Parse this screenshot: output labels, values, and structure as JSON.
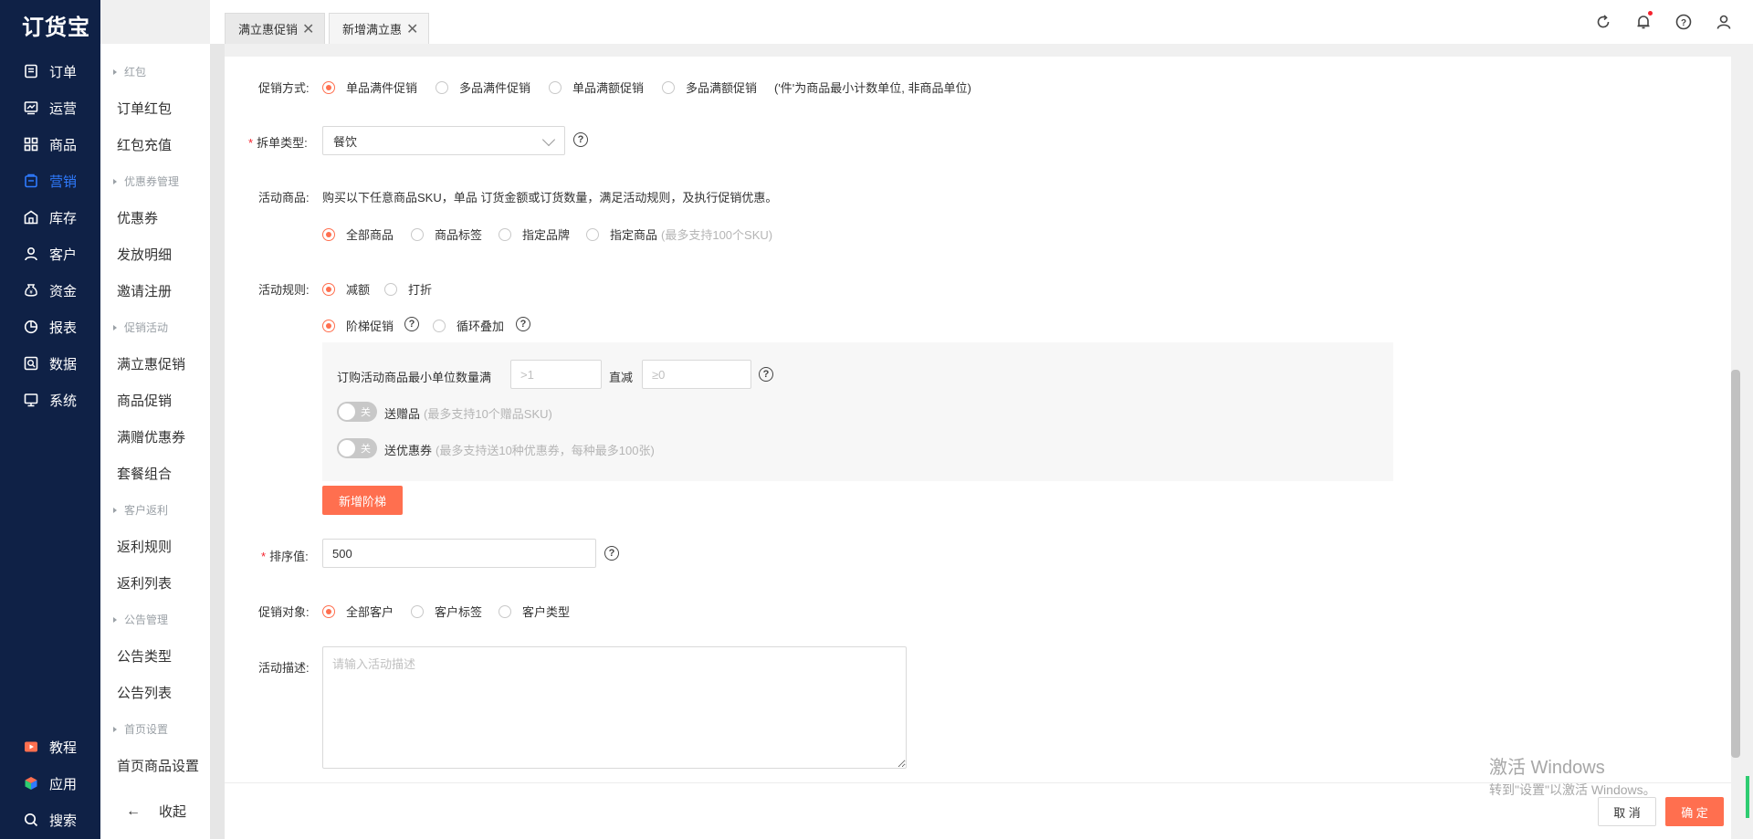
{
  "app": {
    "logo": "订货宝"
  },
  "sidebar": {
    "items": [
      {
        "label": "订单",
        "icon": "order-icon"
      },
      {
        "label": "运营",
        "icon": "operation-icon"
      },
      {
        "label": "商品",
        "icon": "product-icon"
      },
      {
        "label": "营销",
        "icon": "marketing-icon",
        "active": true
      },
      {
        "label": "库存",
        "icon": "warehouse-icon"
      },
      {
        "label": "客户",
        "icon": "customer-icon"
      },
      {
        "label": "资金",
        "icon": "funds-icon"
      },
      {
        "label": "报表",
        "icon": "report-icon"
      },
      {
        "label": "数据",
        "icon": "data-icon"
      },
      {
        "label": "系统",
        "icon": "system-icon"
      }
    ],
    "bottom": [
      {
        "label": "教程",
        "icon": "tutorial-icon"
      },
      {
        "label": "应用",
        "icon": "apps-icon"
      },
      {
        "label": "搜索",
        "icon": "search-icon"
      }
    ]
  },
  "submenu": {
    "groups": [
      {
        "title": "红包",
        "items": [
          "订单红包",
          "红包充值"
        ]
      },
      {
        "title": "优惠券管理",
        "items": [
          "优惠券",
          "发放明细",
          "邀请注册"
        ]
      },
      {
        "title": "促销活动",
        "items": [
          "满立惠促销",
          "商品促销",
          "满赠优惠券",
          "套餐组合"
        ]
      },
      {
        "title": "客户返利",
        "items": [
          "返利规则",
          "返利列表"
        ]
      },
      {
        "title": "公告管理",
        "items": [
          "公告类型",
          "公告列表"
        ]
      },
      {
        "title": "首页设置",
        "items": [
          "首页商品设置"
        ]
      }
    ],
    "collapse_label": "收起"
  },
  "tabs": [
    {
      "label": "满立惠促销",
      "active": false
    },
    {
      "label": "新增满立惠",
      "active": true
    }
  ],
  "topbar": {
    "icons": [
      "refresh-icon",
      "bell-icon",
      "help-icon",
      "user-icon"
    ],
    "accent": "#f5222d"
  },
  "form": {
    "promo_method": {
      "label": "促销方式:",
      "options": [
        "单品满件促销",
        "多品满件促销",
        "单品满额促销",
        "多品满额促销"
      ],
      "selected": 0,
      "note": "('件'为商品最小计数单位, 非商品单位)"
    },
    "split_type": {
      "label": "拆单类型:",
      "value": "餐饮"
    },
    "activity_goods": {
      "label": "活动商品:",
      "description": "购买以下任意商品SKU，单品 订货金额或订货数量，满足活动规则，及执行促销优惠。",
      "options": [
        "全部商品",
        "商品标签",
        "指定品牌",
        "指定商品"
      ],
      "selected": 0,
      "hint": "(最多支持100个SKU)"
    },
    "activity_rules": {
      "label": "活动规则:",
      "options": [
        "减额",
        "打折"
      ],
      "selected": 0,
      "mode_options": [
        "阶梯促销",
        "循环叠加"
      ],
      "mode_selected": 0
    },
    "tier": {
      "condition_label": "订购活动商品最小单位数量满",
      "qty_placeholder": ">1",
      "reduce_label": "直减",
      "reduce_placeholder": "≥0",
      "gift": {
        "label": "送赠品",
        "hint": "(最多支持10个赠品SKU)",
        "state": "关"
      },
      "coupon": {
        "label": "送优惠券",
        "hint": "(最多支持送10种优惠券，每种最多100张)",
        "state": "关"
      }
    },
    "add_tier_button": "新增阶梯",
    "sort_value": {
      "label": "排序值:",
      "value": "500"
    },
    "target": {
      "label": "促销对象:",
      "options": [
        "全部客户",
        "客户标签",
        "客户类型"
      ],
      "selected": 0
    },
    "description": {
      "label": "活动描述:",
      "placeholder": "请输入活动描述"
    }
  },
  "footer": {
    "cancel": "取 消",
    "confirm": "确 定"
  },
  "watermark": {
    "line1": "激活 Windows",
    "line2": "转到\"设置\"以激活 Windows。"
  },
  "colors": {
    "sidebar_bg": "#0f2146",
    "accent": "#ff6f4f",
    "active_nav": "#2f7bff"
  }
}
